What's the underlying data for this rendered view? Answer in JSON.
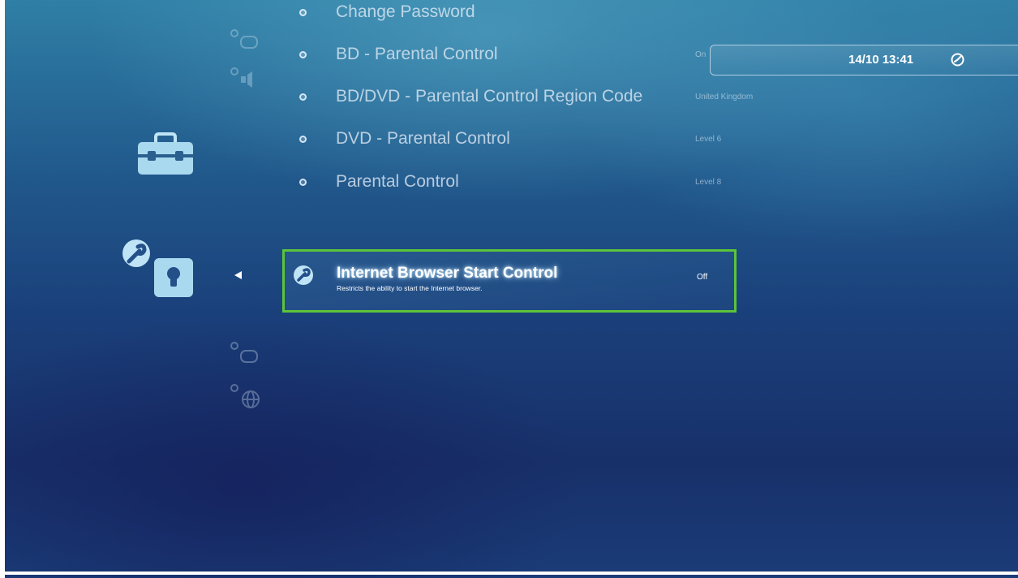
{
  "menu": {
    "items": [
      {
        "label": "Change Password",
        "value": ""
      },
      {
        "label": "BD - Parental Control",
        "value": "On"
      },
      {
        "label": "BD/DVD - Parental Control Region Code",
        "value": "United Kingdom"
      },
      {
        "label": "DVD - Parental Control",
        "value": "Level 6"
      },
      {
        "label": "Parental Control",
        "value": "Level 8"
      }
    ],
    "selected": {
      "title": "Internet Browser Start Control",
      "description": "Restricts the ability to start the Internet browser.",
      "value": "Off"
    }
  },
  "status_bar": {
    "clock": "14/10 13:41"
  },
  "icons": {
    "category": "toolbox-icon",
    "subcategory": "security-lock-icon",
    "selected_item": "wrench-icon",
    "clock": "clock-icon",
    "back": "back-arrow-icon"
  },
  "colors": {
    "selection_border": "#5cc43a",
    "background_top": "#2f7fa6",
    "background_bottom": "#18306a"
  }
}
